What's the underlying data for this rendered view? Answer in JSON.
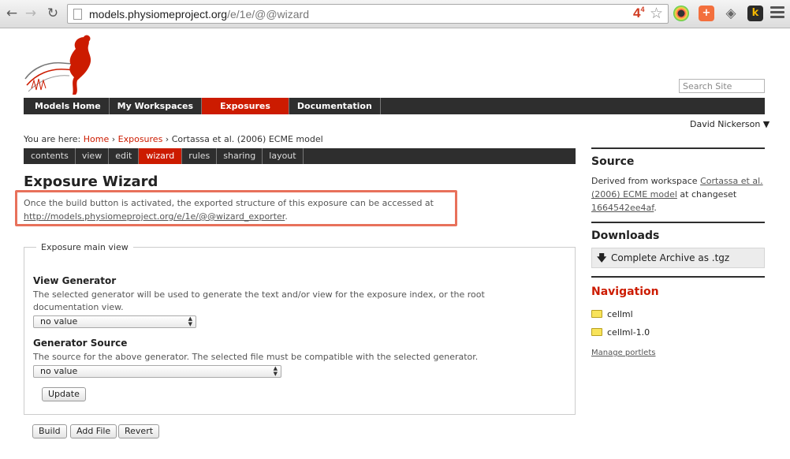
{
  "browser": {
    "url_host": "models.physiomeproject.org",
    "url_path": "/e/1e/@@wizard",
    "badge_count": "4",
    "badge_sup": "4"
  },
  "site": {
    "search_placeholder": "Search Site",
    "global_nav": [
      "Models Home",
      "My Workspaces",
      "Exposures",
      "Documentation"
    ],
    "global_nav_active": "Exposures",
    "user_menu": "David Nickerson ▼",
    "brand_color": "#cc1b00"
  },
  "breadcrumbs": {
    "prefix": "You are here:",
    "home": "Home",
    "sep1": "›",
    "exposures": "Exposures",
    "sep2": "›",
    "current": "Cortassa et al. (2006) ECME model"
  },
  "content_tabs": [
    "contents",
    "view",
    "edit",
    "wizard",
    "rules",
    "sharing",
    "layout"
  ],
  "content_tabs_active": "wizard",
  "page": {
    "title": "Exposure Wizard",
    "desc_line1": "Once the build button is activated, the exported structure of this exposure can be accessed at",
    "desc_link": "http://models.physiomeproject.org/e/1e/@@wizard_exporter",
    "desc_end": "."
  },
  "form": {
    "legend": "Exposure main view",
    "view_generator_label": "View Generator",
    "view_generator_help": "The selected generator will be used to generate the text and/or view for the exposure index, or the root documentation view.",
    "view_generator_value": "no value",
    "generator_source_label": "Generator Source",
    "generator_source_help": "The source for the above generator. The selected file must be compatible with the selected generator.",
    "generator_source_value": "no value",
    "update_label": "Update"
  },
  "actions": {
    "build": "Build",
    "add_file": "Add File",
    "revert": "Revert"
  },
  "sidebar": {
    "source_title": "Source",
    "source_prefix": "Derived from workspace",
    "source_link": "Cortassa et al. (2006) ECME model",
    "source_mid": "at changeset",
    "source_changeset": "1664542ee4af",
    "source_end": ".",
    "downloads_title": "Downloads",
    "download_label": "Complete Archive as .tgz",
    "navigation_title": "Navigation",
    "nav_items": [
      "cellml",
      "cellml-1.0"
    ],
    "manage_portlets": "Manage portlets"
  }
}
